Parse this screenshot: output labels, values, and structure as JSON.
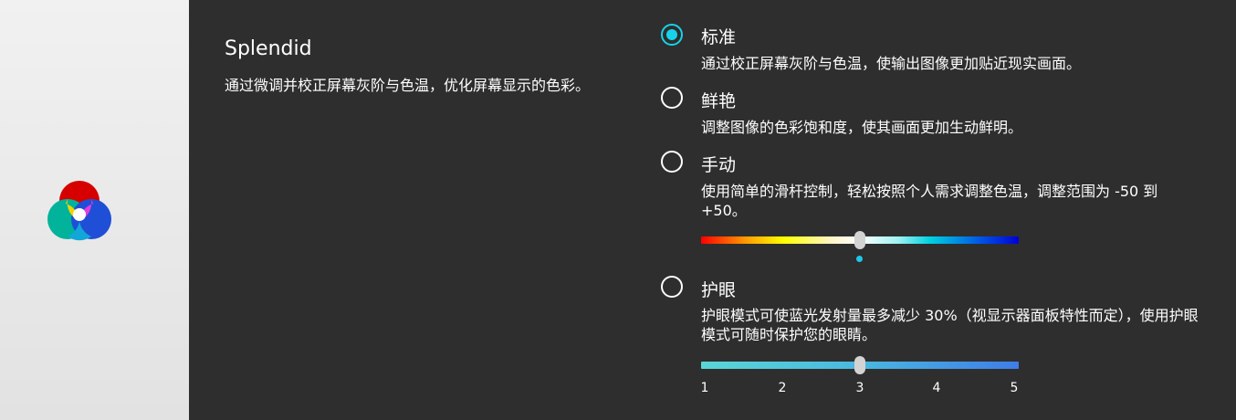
{
  "app": {
    "title": "Splendid",
    "description": "通过微调并校正屏幕灰阶与色温，优化屏幕显示的色彩。"
  },
  "options": [
    {
      "label": "标准",
      "description": "通过校正屏幕灰阶与色温，使输出图像更加贴近现实画面。",
      "selected": true
    },
    {
      "label": "鲜艳",
      "description": "调整图像的色彩饱和度，使其画面更加生动鲜明。",
      "selected": false
    },
    {
      "label": "手动",
      "description": "使用简单的滑杆控制，轻松按照个人需求调整色温，调整范围为 -50 到 +50。",
      "selected": false
    },
    {
      "label": "护眼",
      "description": "护眼模式可使蓝光发射量最多减少 30%（视显示器面板特性而定），使用护眼模式可随时保护您的眼睛。",
      "selected": false
    }
  ],
  "manual_slider": {
    "min": -50,
    "max": 50,
    "value": 0
  },
  "eye_care_slider": {
    "min": 1,
    "max": 5,
    "value": 3,
    "ticks": [
      "1",
      "2",
      "3",
      "4",
      "5"
    ]
  },
  "colors": {
    "accent": "#17d3e8",
    "background": "#2e2e2e",
    "sidebar": "#ebebeb"
  },
  "icons": {
    "app_logo": "rgb-circles-logo-icon"
  }
}
